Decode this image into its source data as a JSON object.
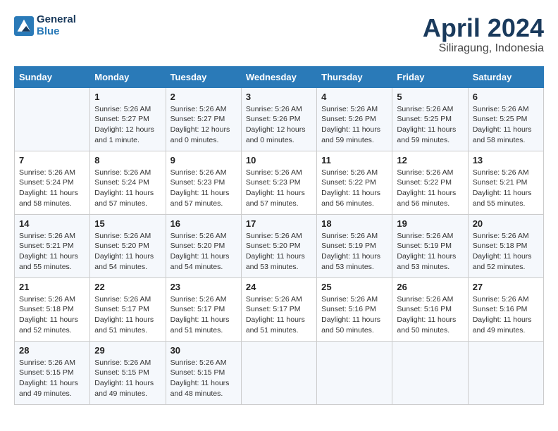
{
  "header": {
    "logo_line1": "General",
    "logo_line2": "Blue",
    "month_year": "April 2024",
    "location": "Siliragung, Indonesia"
  },
  "days_of_week": [
    "Sunday",
    "Monday",
    "Tuesday",
    "Wednesday",
    "Thursday",
    "Friday",
    "Saturday"
  ],
  "weeks": [
    [
      {
        "day": "",
        "info": ""
      },
      {
        "day": "1",
        "info": "Sunrise: 5:26 AM\nSunset: 5:27 PM\nDaylight: 12 hours\nand 1 minute."
      },
      {
        "day": "2",
        "info": "Sunrise: 5:26 AM\nSunset: 5:27 PM\nDaylight: 12 hours\nand 0 minutes."
      },
      {
        "day": "3",
        "info": "Sunrise: 5:26 AM\nSunset: 5:26 PM\nDaylight: 12 hours\nand 0 minutes."
      },
      {
        "day": "4",
        "info": "Sunrise: 5:26 AM\nSunset: 5:26 PM\nDaylight: 11 hours\nand 59 minutes."
      },
      {
        "day": "5",
        "info": "Sunrise: 5:26 AM\nSunset: 5:25 PM\nDaylight: 11 hours\nand 59 minutes."
      },
      {
        "day": "6",
        "info": "Sunrise: 5:26 AM\nSunset: 5:25 PM\nDaylight: 11 hours\nand 58 minutes."
      }
    ],
    [
      {
        "day": "7",
        "info": "Sunrise: 5:26 AM\nSunset: 5:24 PM\nDaylight: 11 hours\nand 58 minutes."
      },
      {
        "day": "8",
        "info": "Sunrise: 5:26 AM\nSunset: 5:24 PM\nDaylight: 11 hours\nand 57 minutes."
      },
      {
        "day": "9",
        "info": "Sunrise: 5:26 AM\nSunset: 5:23 PM\nDaylight: 11 hours\nand 57 minutes."
      },
      {
        "day": "10",
        "info": "Sunrise: 5:26 AM\nSunset: 5:23 PM\nDaylight: 11 hours\nand 57 minutes."
      },
      {
        "day": "11",
        "info": "Sunrise: 5:26 AM\nSunset: 5:22 PM\nDaylight: 11 hours\nand 56 minutes."
      },
      {
        "day": "12",
        "info": "Sunrise: 5:26 AM\nSunset: 5:22 PM\nDaylight: 11 hours\nand 56 minutes."
      },
      {
        "day": "13",
        "info": "Sunrise: 5:26 AM\nSunset: 5:21 PM\nDaylight: 11 hours\nand 55 minutes."
      }
    ],
    [
      {
        "day": "14",
        "info": "Sunrise: 5:26 AM\nSunset: 5:21 PM\nDaylight: 11 hours\nand 55 minutes."
      },
      {
        "day": "15",
        "info": "Sunrise: 5:26 AM\nSunset: 5:20 PM\nDaylight: 11 hours\nand 54 minutes."
      },
      {
        "day": "16",
        "info": "Sunrise: 5:26 AM\nSunset: 5:20 PM\nDaylight: 11 hours\nand 54 minutes."
      },
      {
        "day": "17",
        "info": "Sunrise: 5:26 AM\nSunset: 5:20 PM\nDaylight: 11 hours\nand 53 minutes."
      },
      {
        "day": "18",
        "info": "Sunrise: 5:26 AM\nSunset: 5:19 PM\nDaylight: 11 hours\nand 53 minutes."
      },
      {
        "day": "19",
        "info": "Sunrise: 5:26 AM\nSunset: 5:19 PM\nDaylight: 11 hours\nand 53 minutes."
      },
      {
        "day": "20",
        "info": "Sunrise: 5:26 AM\nSunset: 5:18 PM\nDaylight: 11 hours\nand 52 minutes."
      }
    ],
    [
      {
        "day": "21",
        "info": "Sunrise: 5:26 AM\nSunset: 5:18 PM\nDaylight: 11 hours\nand 52 minutes."
      },
      {
        "day": "22",
        "info": "Sunrise: 5:26 AM\nSunset: 5:17 PM\nDaylight: 11 hours\nand 51 minutes."
      },
      {
        "day": "23",
        "info": "Sunrise: 5:26 AM\nSunset: 5:17 PM\nDaylight: 11 hours\nand 51 minutes."
      },
      {
        "day": "24",
        "info": "Sunrise: 5:26 AM\nSunset: 5:17 PM\nDaylight: 11 hours\nand 51 minutes."
      },
      {
        "day": "25",
        "info": "Sunrise: 5:26 AM\nSunset: 5:16 PM\nDaylight: 11 hours\nand 50 minutes."
      },
      {
        "day": "26",
        "info": "Sunrise: 5:26 AM\nSunset: 5:16 PM\nDaylight: 11 hours\nand 50 minutes."
      },
      {
        "day": "27",
        "info": "Sunrise: 5:26 AM\nSunset: 5:16 PM\nDaylight: 11 hours\nand 49 minutes."
      }
    ],
    [
      {
        "day": "28",
        "info": "Sunrise: 5:26 AM\nSunset: 5:15 PM\nDaylight: 11 hours\nand 49 minutes."
      },
      {
        "day": "29",
        "info": "Sunrise: 5:26 AM\nSunset: 5:15 PM\nDaylight: 11 hours\nand 49 minutes."
      },
      {
        "day": "30",
        "info": "Sunrise: 5:26 AM\nSunset: 5:15 PM\nDaylight: 11 hours\nand 48 minutes."
      },
      {
        "day": "",
        "info": ""
      },
      {
        "day": "",
        "info": ""
      },
      {
        "day": "",
        "info": ""
      },
      {
        "day": "",
        "info": ""
      }
    ]
  ]
}
